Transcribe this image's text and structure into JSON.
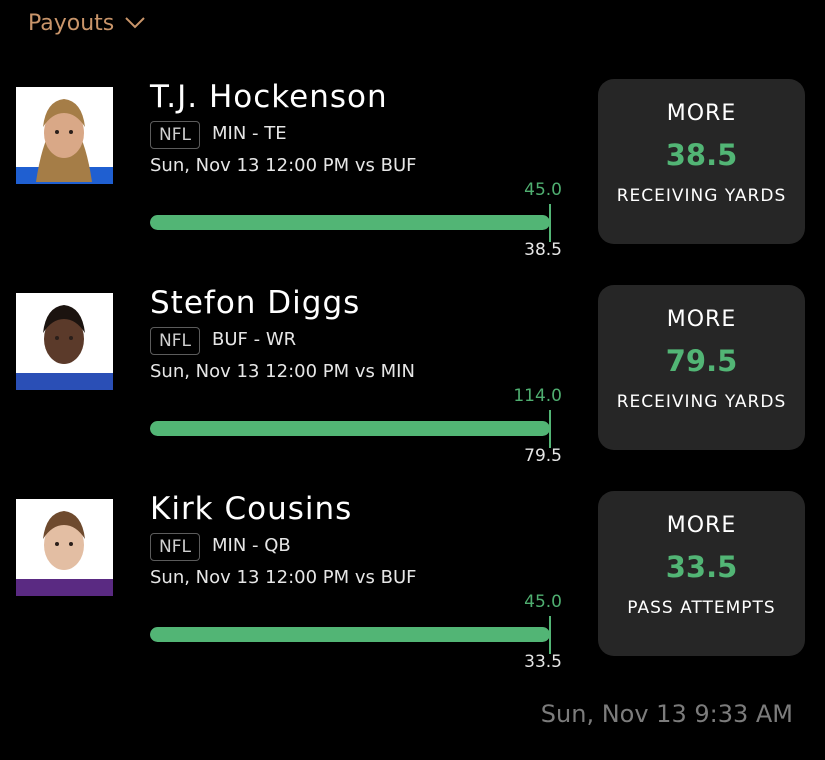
{
  "header": {
    "label": "Payouts"
  },
  "picks": [
    {
      "player": "T.J. Hockenson",
      "league": "NFL",
      "team_position": "MIN - TE",
      "game": "Sun, Nov 13 12:00 PM  vs BUF",
      "actual": "45.0",
      "line": "38.5",
      "progress": 1.0,
      "direction": "MORE",
      "stat_value": "38.5",
      "stat_type": "RECEIVING YARDS",
      "jersey_color": "#1f5fd1",
      "skin_color": "#d9a887",
      "hair_color": "#a57d47",
      "hair_style": "long"
    },
    {
      "player": "Stefon Diggs",
      "league": "NFL",
      "team_position": "BUF - WR",
      "game": "Sun, Nov 13 12:00 PM  vs MIN",
      "actual": "114.0",
      "line": "79.5",
      "progress": 1.0,
      "direction": "MORE",
      "stat_value": "79.5",
      "stat_type": "RECEIVING YARDS",
      "jersey_color": "#2a4fb6",
      "skin_color": "#5b3a2a",
      "hair_color": "#1b130f",
      "hair_style": "short"
    },
    {
      "player": "Kirk Cousins",
      "league": "NFL",
      "team_position": "MIN - QB",
      "game": "Sun, Nov 13 12:00 PM  vs BUF",
      "actual": "45.0",
      "line": "33.5",
      "progress": 1.0,
      "direction": "MORE",
      "stat_value": "33.5",
      "stat_type": "PASS ATTEMPTS",
      "jersey_color": "#5a2a82",
      "skin_color": "#e3bea3",
      "hair_color": "#6e4a2e",
      "hair_style": "short"
    }
  ],
  "timestamp": "Sun, Nov 13 9:33 AM",
  "colors": {
    "accent": "#52b575",
    "header": "#c9956a",
    "card_bg": "#262626"
  }
}
